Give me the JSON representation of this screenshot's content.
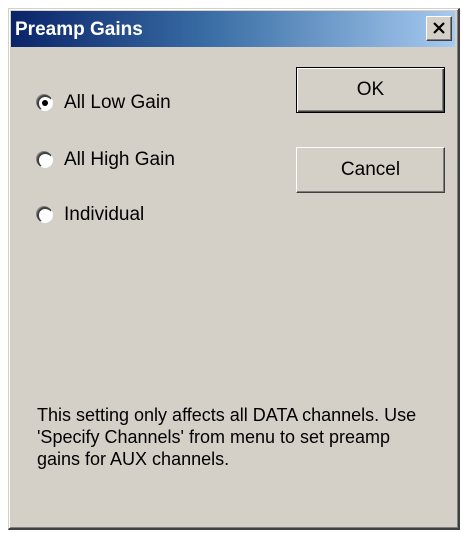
{
  "window": {
    "title": "Preamp Gains",
    "close_icon": "close-icon"
  },
  "gain_options": [
    {
      "label": "All Low Gain",
      "selected": true
    },
    {
      "label": "All High Gain",
      "selected": false
    },
    {
      "label": "Individual",
      "selected": false
    }
  ],
  "buttons": {
    "ok_label": "OK",
    "cancel_label": "Cancel"
  },
  "note": "This setting only affects all DATA channels.  Use 'Specify Channels' from menu to set preamp gains for AUX channels.",
  "colors": {
    "titlebar_start": "#0a246a",
    "titlebar_end": "#a6caf0",
    "dialog_face": "#d4d0c8"
  }
}
